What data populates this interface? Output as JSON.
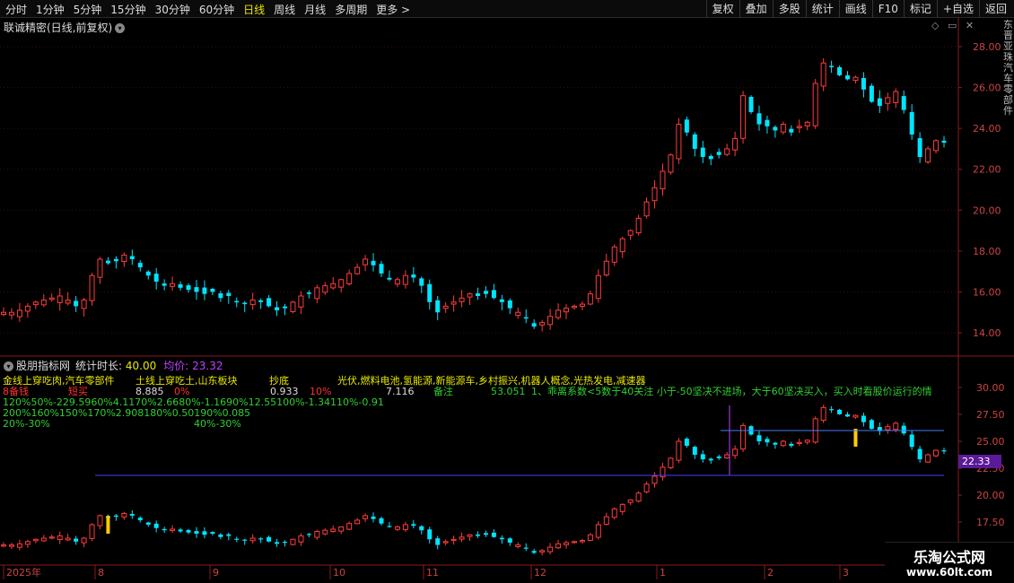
{
  "toolbar": {
    "periods": [
      "分时",
      "1分钟",
      "5分钟",
      "15分钟",
      "30分钟",
      "60分钟",
      "日线",
      "周线",
      "月线",
      "多周期",
      "更多 >"
    ],
    "active_period": "日线",
    "tools": [
      "复权",
      "叠加",
      "多股",
      "统计",
      "画线",
      "F10",
      "标记",
      "+自选",
      "返回"
    ]
  },
  "stock": {
    "title": "联诚精密(日线,前复权)",
    "settings_icon": "chevron-down-icon"
  },
  "panel_controls": {
    "icons": [
      "diamond-icon",
      "window-icon",
      "close-icon"
    ]
  },
  "right_strip_text": "东晋亚珠汽车零部件",
  "main_axis": {
    "ticks": [
      "28.00",
      "26.00",
      "24.00",
      "22.00",
      "20.00",
      "18.00",
      "16.00",
      "14.00"
    ]
  },
  "indicator": {
    "name": "股朋指标网",
    "stat_label": "统计时长:",
    "stat_value": "40.00",
    "avg_label": "均价:",
    "avg_value": "23.32",
    "axis_ticks": [
      "30.00",
      "27.50",
      "25.00",
      "22.50",
      "20.00",
      "17.50"
    ],
    "current_price_tag": "22.33",
    "annotations": {
      "l1a": "金线上穿吃肉,汽车零部件",
      "l1b": "土线上穿吃土,山东板块",
      "l1c": "抄底",
      "l1d": "光伏,燃料电池,氢能源,新能源车,乡村振兴,机器人概念,光热发电,减速器",
      "l2a": "8备钱",
      "l2b": "短买",
      "l2c": "8.885",
      "l2d": "0%",
      "l2e": "0.933",
      "l2f": "10%",
      "l2g": "7.116",
      "l2h": "备注",
      "l2i": "53.051",
      "l2j": "1、乖离系数<5数于40关注 小于-50坚决不进场，大于60坚决买入，买入时看股价运行的情",
      "l3": "120%50%-229.5960%4.1170%2.6680%-1.1690%12.55100%-1.34110%-0.91",
      "l4": "200%160%150%170%2.908180%0.50190%0.085",
      "l5a": "20%-30%",
      "l5b": "40%-30%"
    }
  },
  "date_axis": {
    "labels": [
      "2025年",
      "8",
      "9",
      "10",
      "11",
      "12",
      "1",
      "2",
      "3"
    ]
  },
  "watermark": {
    "line1": "乐淘公式网",
    "line2": "www.60lt.com"
  },
  "chart_data": {
    "type": "candlestick",
    "title": "联诚精密(日线,前复权)",
    "ylim": [
      13.5,
      28.5
    ],
    "x_month_labels": [
      "2025年",
      "8",
      "9",
      "10",
      "11",
      "12",
      "1",
      "2",
      "3"
    ],
    "close_path": [
      15.0,
      15.0,
      15.1,
      15.3,
      15.5,
      15.6,
      15.7,
      15.8,
      15.6,
      15.3,
      15.6,
      16.8,
      17.6,
      17.4,
      17.5,
      17.8,
      17.6,
      17.2,
      16.8,
      16.5,
      16.3,
      16.4,
      16.2,
      16.1,
      16.0,
      15.9,
      16.0,
      15.7,
      15.8,
      15.5,
      15.4,
      15.6,
      15.5,
      15.3,
      15.1,
      15.2,
      15.5,
      15.8,
      15.9,
      16.2,
      16.3,
      16.4,
      16.6,
      16.9,
      17.2,
      17.6,
      17.3,
      16.9,
      16.6,
      16.6,
      16.8,
      16.7,
      16.3,
      15.5,
      15.0,
      15.3,
      15.5,
      15.7,
      15.9,
      15.8,
      15.9,
      15.7,
      15.5,
      15.2,
      15.0,
      14.7,
      14.3,
      14.5,
      14.8,
      15.1,
      15.2,
      15.3,
      15.4,
      15.9,
      16.8,
      17.5,
      18.2,
      18.6,
      19.0,
      19.6,
      20.4,
      21.1,
      21.9,
      22.7,
      24.2,
      23.8,
      23.0,
      22.6,
      22.5,
      22.7,
      23.0,
      23.5,
      25.6,
      24.8,
      24.2,
      24.1,
      23.9,
      24.2,
      23.8,
      24.1,
      24.3,
      26.2,
      27.2,
      27.0,
      26.6,
      26.4,
      26.5,
      25.9,
      25.3,
      25.1,
      25.5,
      25.8,
      24.9,
      23.7,
      22.6,
      23.0,
      23.4,
      23.3
    ],
    "volume_price_level": 20.9,
    "resistance_level": 26.0
  }
}
